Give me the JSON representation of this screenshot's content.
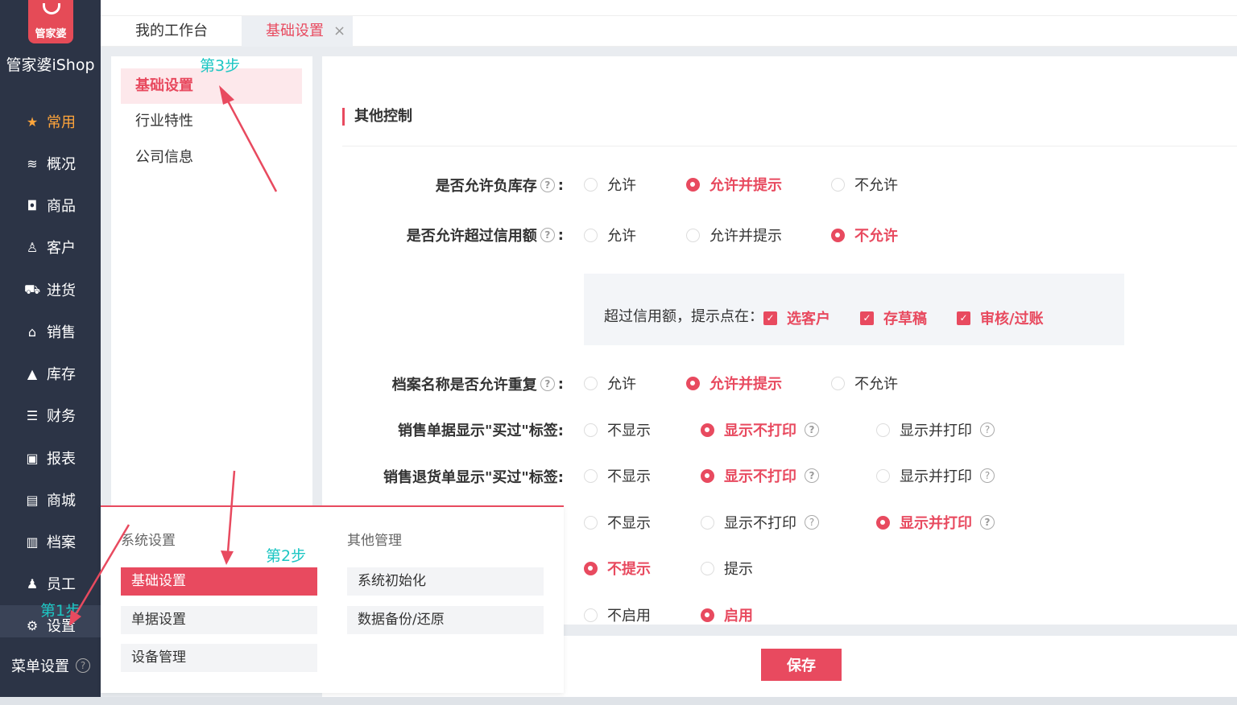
{
  "app": {
    "logo_text": "管家婆",
    "name": "管家婆iShop"
  },
  "sidebar": {
    "items": [
      {
        "label": "常用",
        "icon": "star-icon"
      },
      {
        "label": "概况",
        "icon": "layers-icon"
      },
      {
        "label": "商品",
        "icon": "bag-icon"
      },
      {
        "label": "客户",
        "icon": "customer-icon"
      },
      {
        "label": "进货",
        "icon": "cart-icon"
      },
      {
        "label": "销售",
        "icon": "basket-icon"
      },
      {
        "label": "库存",
        "icon": "warehouse-icon"
      },
      {
        "label": "财务",
        "icon": "money-icon"
      },
      {
        "label": "报表",
        "icon": "chart-icon"
      },
      {
        "label": "商城",
        "icon": "shop-icon"
      },
      {
        "label": "档案",
        "icon": "archive-icon"
      },
      {
        "label": "员工",
        "icon": "staff-icon"
      },
      {
        "label": "设置",
        "icon": "gear-icon"
      }
    ],
    "menu_setting": "菜单设置"
  },
  "tabs": {
    "home": "我的工作台",
    "active": "基础设置",
    "close": "×"
  },
  "subnav": {
    "items": [
      "基础设置",
      "行业特性",
      "公司信息"
    ]
  },
  "section": {
    "title": "其他控制"
  },
  "rows": {
    "neg_stock": {
      "label": "是否允许负库存",
      "opts": [
        "允许",
        "允许并提示",
        "不允许"
      ]
    },
    "over_credit": {
      "label": "是否允许超过信用额",
      "opts": [
        "允许",
        "允许并提示",
        "不允许"
      ]
    },
    "dup_name": {
      "label": "档案名称是否允许重复",
      "opts": [
        "允许",
        "允许并提示",
        "不允许"
      ]
    },
    "sale_tag": {
      "label": "销售单据显示\"买过\"标签:",
      "opts": [
        "不显示",
        "显示不打印",
        "显示并打印"
      ]
    },
    "return_tag": {
      "label": "销售退货单显示\"买过\"标签:",
      "opts": [
        "不显示",
        "显示不打印",
        "显示并打印"
      ]
    },
    "row6": {
      "opts": [
        "不显示",
        "显示不打印",
        "显示并打印"
      ]
    },
    "row7": {
      "opts": [
        "不提示",
        "提示"
      ]
    },
    "row8": {
      "opts": [
        "不启用",
        "启用"
      ]
    }
  },
  "credit": {
    "text": "超过信用额，提示点在：",
    "checks": [
      "选客户",
      "存草稿",
      "审核/过账"
    ]
  },
  "save_label": "保存",
  "popup": {
    "col1_head": "系统设置",
    "col1": [
      "基础设置",
      "单据设置",
      "设备管理"
    ],
    "col2_head": "其他管理",
    "col2": [
      "系统初始化",
      "数据备份/还原"
    ]
  },
  "annotations": {
    "step1": "第1步",
    "step2": "第2步",
    "step3": "第3步"
  },
  "colors": {
    "accent": "#e84a5f",
    "sidebar_bg": "#2c3446",
    "active_nav": "#ffa53b",
    "annotation": "#1cc6c3"
  }
}
